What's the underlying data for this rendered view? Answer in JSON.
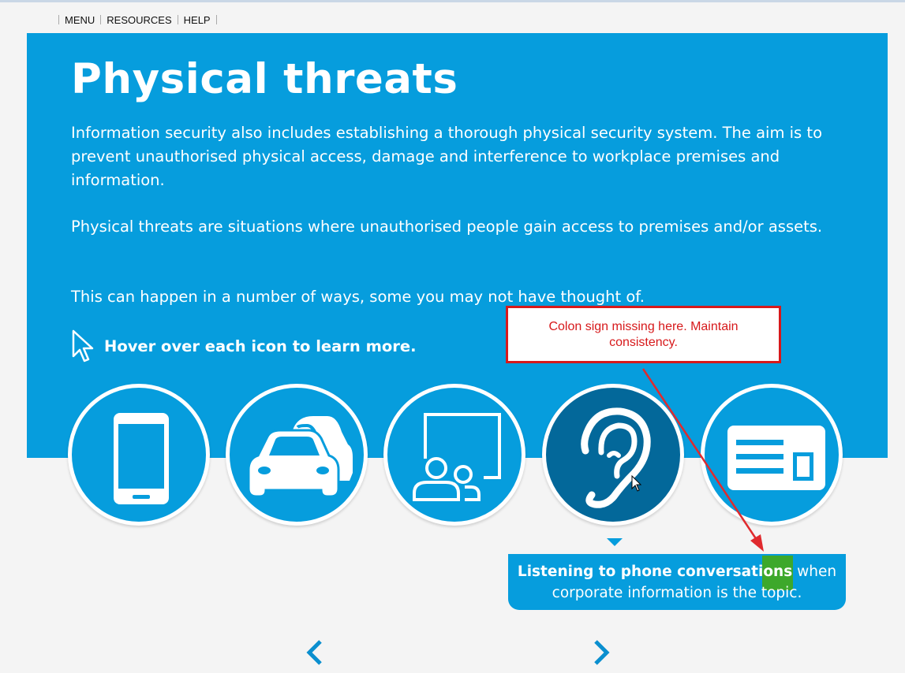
{
  "nav": {
    "items": [
      "MENU",
      "RESOURCES",
      "HELP"
    ]
  },
  "main": {
    "title": "Physical threats",
    "paragraphs": [
      "Information security also includes establishing a thorough physical security system. The aim is to prevent unauthorised physical access, damage and interference to workplace premises and information.",
      "Physical threats are situations where unauthorised people gain access to premises and/or assets.",
      "This can happen in a number of ways, some you may not have thought of."
    ],
    "hint": "Hover over each icon to learn more."
  },
  "icons": [
    {
      "icon": "smartphone-icon"
    },
    {
      "icon": "cars-icon"
    },
    {
      "icon": "presentation-people-icon"
    },
    {
      "icon": "ear-icon",
      "active": true
    },
    {
      "icon": "id-card-icon"
    }
  ],
  "tooltip": {
    "bold": "Listening to phone conversations",
    "rest": " when corporate information is the topic."
  },
  "annotation": {
    "text": "Colon sign missing here. Maintain consistency."
  },
  "colors": {
    "brand_blue": "#069ddd",
    "active_blue": "#03689a",
    "annotation_red": "#d7191b",
    "highlight_green": "#3da82b"
  }
}
